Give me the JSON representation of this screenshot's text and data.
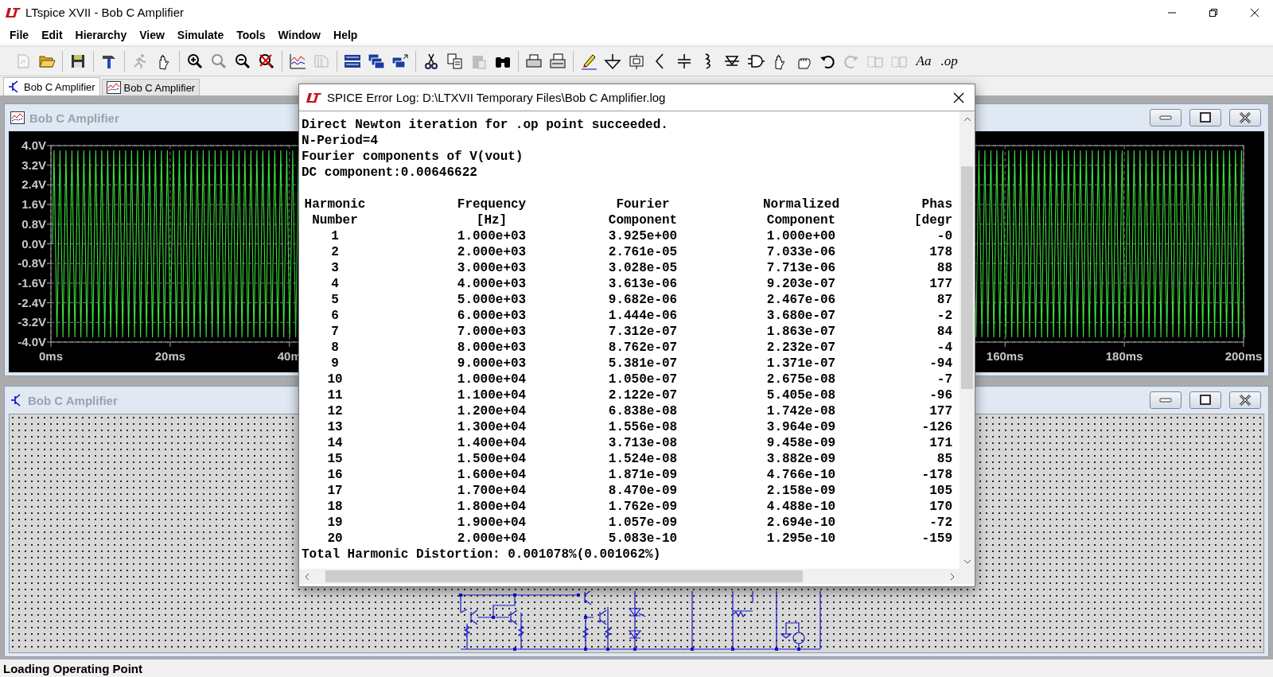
{
  "window": {
    "title": "LTspice XVII - Bob C Amplifier"
  },
  "menu": [
    "File",
    "Edit",
    "Hierarchy",
    "View",
    "Simulate",
    "Tools",
    "Window",
    "Help"
  ],
  "toolbar": {
    "buttons": [
      {
        "kind": "new",
        "disabled": true
      },
      {
        "kind": "open",
        "disabled": false
      },
      {
        "kind": "separator"
      },
      {
        "kind": "save",
        "disabled": false
      },
      {
        "kind": "separator"
      },
      {
        "kind": "hammer",
        "disabled": false
      },
      {
        "kind": "separator"
      },
      {
        "kind": "run",
        "disabled": true
      },
      {
        "kind": "halt",
        "disabled": false
      },
      {
        "kind": "separator"
      },
      {
        "kind": "zoom-in",
        "disabled": false
      },
      {
        "kind": "zoom-fit",
        "disabled": true
      },
      {
        "kind": "zoom-out",
        "disabled": false
      },
      {
        "kind": "zoom-cancel",
        "disabled": false
      },
      {
        "kind": "separator"
      },
      {
        "kind": "plot",
        "disabled": false
      },
      {
        "kind": "plot-setup",
        "disabled": true
      },
      {
        "kind": "separator"
      },
      {
        "kind": "tile",
        "disabled": false
      },
      {
        "kind": "cascade",
        "disabled": false
      },
      {
        "kind": "windows",
        "disabled": false
      },
      {
        "kind": "separator"
      },
      {
        "kind": "cut",
        "disabled": false
      },
      {
        "kind": "copy",
        "disabled": false
      },
      {
        "kind": "paste",
        "disabled": true
      },
      {
        "kind": "find",
        "disabled": false
      },
      {
        "kind": "separator"
      },
      {
        "kind": "print",
        "disabled": false
      },
      {
        "kind": "print-setup",
        "disabled": false
      },
      {
        "kind": "separator"
      },
      {
        "kind": "pencil",
        "disabled": false
      },
      {
        "kind": "ground",
        "disabled": false
      },
      {
        "kind": "label",
        "disabled": false
      },
      {
        "kind": "resistor",
        "disabled": false
      },
      {
        "kind": "capacitor",
        "disabled": false
      },
      {
        "kind": "inductor",
        "disabled": false
      },
      {
        "kind": "diode",
        "disabled": false
      },
      {
        "kind": "component",
        "disabled": false
      },
      {
        "kind": "move",
        "disabled": false
      },
      {
        "kind": "drag",
        "disabled": false
      },
      {
        "kind": "undo",
        "disabled": false
      },
      {
        "kind": "redo",
        "disabled": true
      },
      {
        "kind": "rotate",
        "disabled": true
      },
      {
        "kind": "mirror",
        "disabled": true
      },
      {
        "kind": "text",
        "label": "Aa",
        "disabled": false
      },
      {
        "kind": "text",
        "label": ".op",
        "disabled": false
      }
    ]
  },
  "tabs": [
    {
      "label": "Bob C Amplifier",
      "kind": "schematic",
      "selected": true
    },
    {
      "label": "Bob C Amplifier",
      "kind": "plot",
      "selected": false
    }
  ],
  "plot_window": {
    "title": "Bob C Amplifier",
    "active": false,
    "y_ticks": [
      "4.0V",
      "3.2V",
      "2.4V",
      "1.6V",
      "0.8V",
      "0.0V",
      "-0.8V",
      "-1.6V",
      "-2.4V",
      "-3.2V",
      "-4.0V"
    ],
    "x_ticks": [
      "0ms",
      "20ms",
      "40m",
      "160ms",
      "180ms",
      "200ms"
    ]
  },
  "schematic_window": {
    "title": "Bob C Amplifier",
    "active": false
  },
  "log": {
    "title": "SPICE Error Log: D:\\LTXVII Temporary Files\\Bob C Amplifier.log",
    "lines": [
      "Direct Newton iteration for .op point succeeded.",
      "N-Period=4",
      "Fourier components of V(vout)",
      "DC component:0.00646622"
    ],
    "header_1": [
      "Harmonic",
      "Frequency",
      "Fourier",
      "Normalized",
      "Phas"
    ],
    "header_2": [
      "Number",
      "[Hz]",
      "Component",
      "Component",
      "[degr"
    ],
    "rows": [
      [
        "1",
        "1.000e+03",
        "3.925e+00",
        "1.000e+00",
        "-0"
      ],
      [
        "2",
        "2.000e+03",
        "2.761e-05",
        "7.033e-06",
        "178"
      ],
      [
        "3",
        "3.000e+03",
        "3.028e-05",
        "7.713e-06",
        "88"
      ],
      [
        "4",
        "4.000e+03",
        "3.613e-06",
        "9.203e-07",
        "177"
      ],
      [
        "5",
        "5.000e+03",
        "9.682e-06",
        "2.467e-06",
        "87"
      ],
      [
        "6",
        "6.000e+03",
        "1.444e-06",
        "3.680e-07",
        "-2"
      ],
      [
        "7",
        "7.000e+03",
        "7.312e-07",
        "1.863e-07",
        "84"
      ],
      [
        "8",
        "8.000e+03",
        "8.762e-07",
        "2.232e-07",
        "-4"
      ],
      [
        "9",
        "9.000e+03",
        "5.381e-07",
        "1.371e-07",
        "-94"
      ],
      [
        "10",
        "1.000e+04",
        "1.050e-07",
        "2.675e-08",
        "-7"
      ],
      [
        "11",
        "1.100e+04",
        "2.122e-07",
        "5.405e-08",
        "-96"
      ],
      [
        "12",
        "1.200e+04",
        "6.838e-08",
        "1.742e-08",
        "177"
      ],
      [
        "13",
        "1.300e+04",
        "1.556e-08",
        "3.964e-09",
        "-126"
      ],
      [
        "14",
        "1.400e+04",
        "3.713e-08",
        "9.458e-09",
        "171"
      ],
      [
        "15",
        "1.500e+04",
        "1.524e-08",
        "3.882e-09",
        "85"
      ],
      [
        "16",
        "1.600e+04",
        "1.871e-09",
        "4.766e-10",
        "-178"
      ],
      [
        "17",
        "1.700e+04",
        "8.470e-09",
        "2.158e-09",
        "105"
      ],
      [
        "18",
        "1.800e+04",
        "1.762e-09",
        "4.488e-10",
        "170"
      ],
      [
        "19",
        "1.900e+04",
        "1.057e-09",
        "2.694e-10",
        "-72"
      ],
      [
        "20",
        "2.000e+04",
        "5.083e-10",
        "1.295e-10",
        "-159"
      ]
    ],
    "summary": "Total Harmonic Distortion: 0.001078%(0.001062%)"
  },
  "status_bar": "Loading Operating Point"
}
